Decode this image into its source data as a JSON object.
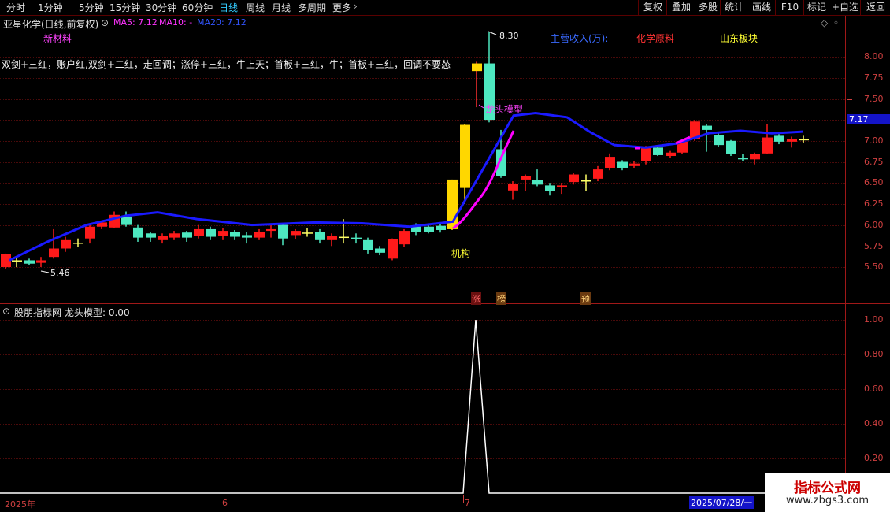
{
  "toolbar": {
    "periods": [
      "分时",
      "1分钟",
      "5分钟",
      "15分钟",
      "30分钟",
      "60分钟",
      "日线",
      "周线",
      "月线",
      "多周期",
      "更多"
    ],
    "active_period": "日线",
    "buttons": [
      "复权",
      "叠加",
      "多股",
      "统计",
      "画线",
      "F10",
      "标记",
      "+自选",
      "返回"
    ]
  },
  "main_panel": {
    "title": "亚星化学(日线,前复权)",
    "ma_labels": {
      "ma5": "MA5: 7.12",
      "ma10": "MA10: -",
      "ma20": "MA20: 7.12"
    },
    "tags": {
      "new_material": "新材料",
      "main_revenue": "主营收入(万):",
      "chem_material": "化学原料",
      "shandong": "山东板块"
    },
    "strategy_text": "双剑+三红，账户红,双剑+二红，走回调；涨停+三红，牛上天；首板+三红，牛；首板+三红，回调不要怂",
    "annotations": {
      "high": "8.30",
      "low": "5.46",
      "dragon": "龙头模型",
      "institution": "机构"
    },
    "markers": [
      "涨",
      "榜",
      "预"
    ],
    "current_price": "7.17",
    "y_ticks": [
      "8.00",
      "7.75",
      "7.50",
      "7.25",
      "7.00",
      "6.75",
      "6.50",
      "6.25",
      "6.00",
      "5.75",
      "5.50"
    ]
  },
  "sub_panel": {
    "title": "股朋指标网",
    "indicator": "龙头模型: 0.00",
    "y_ticks": [
      "1.00",
      "0.80",
      "0.60",
      "0.40",
      "0.20"
    ]
  },
  "time_axis": {
    "labels": [
      "2025年",
      "6",
      "7"
    ],
    "date_box": "2025/07/28/一"
  },
  "watermark": {
    "title": "指标公式网",
    "url": "www.zbgs3.com"
  },
  "colors": {
    "up": "#ff1a1a",
    "down": "#4de8c0",
    "gold": "#ffd700",
    "ma": "#1a1aff",
    "ma_pink": "#ff00ff",
    "axis": "#d04040"
  }
}
